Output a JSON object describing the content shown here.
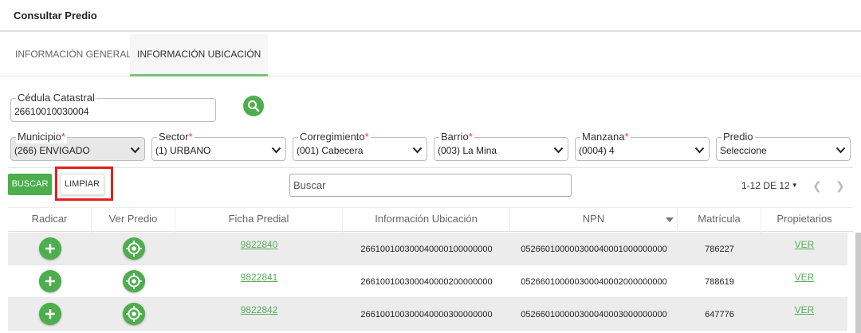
{
  "header": {
    "title": "Consultar Predio"
  },
  "tabs": [
    {
      "label": "INFORMACIÓN GENERAL"
    },
    {
      "label": "INFORMACIÓN UBICACIÓN"
    }
  ],
  "cedula": {
    "label": "Cédula Catastral",
    "value": "26610010030004"
  },
  "filters": {
    "municipio": {
      "label": "Municipio",
      "value": "(266) ENVIGADO"
    },
    "sector": {
      "label": "Sector",
      "value": "(1) URBANO"
    },
    "corregimiento": {
      "label": "Corregimiento",
      "value": "(001) Cabecera"
    },
    "barrio": {
      "label": "Barrio",
      "value": "(003) La Mina"
    },
    "manzana": {
      "label": "Manzana",
      "value": "(0004) 4"
    },
    "predio": {
      "label": "Predio",
      "value": "Seleccione"
    }
  },
  "actions": {
    "buscar": "BUSCAR",
    "limpiar": "LIMPIAR"
  },
  "search": {
    "placeholder": "Buscar"
  },
  "pager": {
    "range": "1-12 DE 12"
  },
  "table": {
    "columns": [
      "Radicar",
      "Ver Predio",
      "Ficha Predial",
      "Información Ubicación",
      "NPN",
      "Matrícula",
      "Propietarios"
    ],
    "rows": [
      {
        "ficha": "9822840",
        "ubicacion": "266100100300040000100000000",
        "npn": "052660100000300040001000000000",
        "matricula": "786227",
        "propietarios": "VER"
      },
      {
        "ficha": "9822841",
        "ubicacion": "266100100300040000200000000",
        "npn": "052660100000300040002000000000",
        "matricula": "788619",
        "propietarios": "VER"
      },
      {
        "ficha": "9822842",
        "ubicacion": "266100100300040000300000000",
        "npn": "052660100000300040003000000000",
        "matricula": "647776",
        "propietarios": "VER"
      }
    ]
  },
  "colors": {
    "accent": "#4cae4c",
    "highlight": "#e02020",
    "required": "#e53935"
  }
}
